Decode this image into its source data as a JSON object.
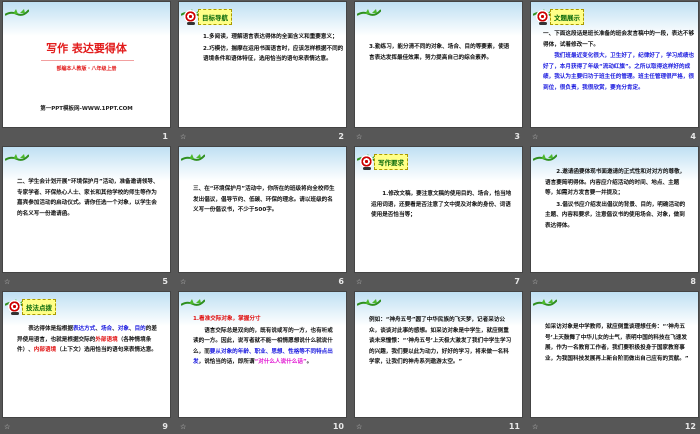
{
  "colors": {
    "black": "#111111",
    "blue": "#1a1adf",
    "red": "#e01010",
    "magenta": "#e010d0",
    "green": "#0a6a0a"
  },
  "slides": [
    {
      "number": "1",
      "title": "写作  表达要得体",
      "subtitle": "部编本人教版・八年级上册",
      "footer": "第一PPT模板网-WWW.1PPT.COM"
    },
    {
      "number": "2",
      "badge": "目标导航",
      "paragraphs": [
        [
          {
            "t": "1.多阅读，理解语言表达得体的全面含义和重要意义；"
          }
        ],
        [
          {
            "t": "2.巧模仿，揣摩在运用书面语言时，应该怎样根据不同的语境条件和语体特征，选用恰当的语句来表情达意。"
          }
        ]
      ]
    },
    {
      "number": "3",
      "paragraphs": [
        [
          {
            "t": "3.勤练习，能分清不同的对象、场合、目的等要素，使语言表达发挥最佳效果，努力提高自己的综合素养。"
          }
        ]
      ]
    },
    {
      "number": "4",
      "badge": "文题展示",
      "paragraphs": [
        [
          {
            "t": "一、下面这段话是班长准备的班会发言稿中的一段，表达不够得体，试着修改一下。"
          }
        ],
        [
          {
            "t": "我们班最近变化很大，卫生好了，纪律好了，学习成绩也好了，本月获得了年级“流动红旗”。之所以取得这样好的成绩，我认为主要归功于班主任的管理。班主任管理很严格，很到位，很负责，我很欣赏，要充分肯定。",
            "c": "blue",
            "indent": true
          }
        ]
      ]
    },
    {
      "number": "5",
      "paragraphs": [
        [
          {
            "t": "二、学生会计划开展“环境保护月”活动，准备邀请领导、专家学者、环保热心人士、家长和其他学校的师生等作为嘉宾参加活动的启动仪式。请你任选一个对象，以学生会的名义写一份邀请函。"
          }
        ]
      ]
    },
    {
      "number": "6",
      "paragraphs": [
        [
          {
            "t": "三、在“环境保护月”活动中，你所在的班级将向全校师生发出倡议，倡导节约、低碳、环保的理念。请以班级的名义写一份倡议书，不少于500字。"
          }
        ]
      ]
    },
    {
      "number": "7",
      "badge": "写作要求",
      "paragraphs": [
        [
          {
            "t": "1.修改文稿，要注意文稿的使用目的、场合，恰当地运用词语，还要看是否注意了文中提及对象的身份、词语使用是否恰当等；",
            "indent": true
          }
        ]
      ]
    },
    {
      "number": "8",
      "paragraphs": [
        [
          {
            "t": "2.邀请函要体现书面邀请的正式性和对对方的尊敬，语言要简明得体。内容应介绍活动的时间、地点、主题等，如需对方发言要一并提及；",
            "indent": true
          }
        ],
        [
          {
            "t": "3.倡议书应介绍发出倡议的背景、目的，明确活动的主题、内容和要求，注意倡议书的使用场合、对象，做到表达得体。",
            "indent": true
          }
        ]
      ]
    },
    {
      "number": "9",
      "badge": "技法点拨",
      "paragraphs": [
        [
          {
            "t": "表达得体是指根据",
            "indent": true
          },
          {
            "t": "表达方式",
            "c": "blue"
          },
          {
            "t": "、"
          },
          {
            "t": "场合",
            "c": "blue"
          },
          {
            "t": "、"
          },
          {
            "t": "对象",
            "c": "blue"
          },
          {
            "t": "、"
          },
          {
            "t": "目的",
            "c": "blue"
          },
          {
            "t": "的差异使用语言，也就是根据交际的"
          },
          {
            "t": "外部语境",
            "c": "red"
          },
          {
            "t": "（各种情境条件）、"
          },
          {
            "t": "内部语境",
            "c": "red"
          },
          {
            "t": "（上下文）选用恰当的语句来表情达意。"
          }
        ]
      ]
    },
    {
      "number": "10",
      "paragraphs": [
        [
          {
            "t": "1.看准交际对象，掌握分寸",
            "c": "red"
          }
        ],
        [
          {
            "t": "语言交际总是双向的，既有说或写的一方，也有听或读的一方。因此，说写者就不能一相情愿想说什么就说什么，而",
            "indent": true
          },
          {
            "t": "要从对象的年龄、职业、思想、性格等不同特点出发",
            "c": "blue"
          },
          {
            "t": "，说恰当的话，即所谓"
          },
          {
            "t": "“对什么人说什么话”",
            "c": "magenta"
          },
          {
            "t": "。"
          }
        ]
      ]
    },
    {
      "number": "11",
      "paragraphs": [
        [
          {
            "t": "例如：“神舟五号”圆了中华民族的飞天梦，记者采访公众，谈谈对此事的感想。如采访对象是中学生，就应侧重谈未来憧憬：“‘神舟五号’上天极大激发了我们中学生学习的兴趣，我们要以此为动力，好好的学习，将来做一名科学家，让我们的神舟系列遨游太空。”"
          }
        ]
      ]
    },
    {
      "number": "12",
      "paragraphs": [
        [
          {
            "t": "如采访对象是中学教师，就应侧重谈理想任务：“‘神舟五号’上天鼓舞了中华儿女的士气，表明中国的科技在飞速发展，作为一名教育工作者，我们要积极投身于国家教育事业，为我国科技发展再上新台阶而做出自己应有的贡献。”"
          }
        ]
      ]
    }
  ]
}
